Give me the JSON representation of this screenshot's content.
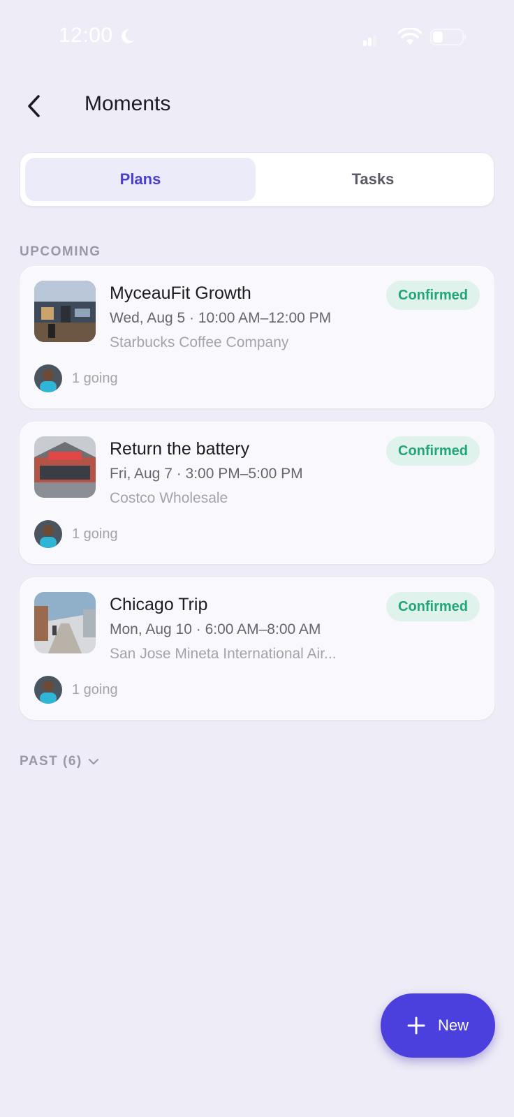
{
  "status_bar": {
    "time": "12:00"
  },
  "header": {
    "title": "Moments"
  },
  "tabs": [
    {
      "label": "Plans",
      "active": true
    },
    {
      "label": "Tasks",
      "active": false
    }
  ],
  "upcoming": {
    "label": "UPCOMING",
    "items": [
      {
        "title": "MyceauFit Growth",
        "time": "Wed, Aug 5 · 10:00 AM–12:00 PM",
        "location": "Starbucks Coffee Company",
        "status": "Confirmed",
        "going": "1 going"
      },
      {
        "title": "Return the battery",
        "time": "Fri, Aug 7 · 3:00 PM–5:00 PM",
        "location": "Costco Wholesale",
        "status": "Confirmed",
        "going": "1 going"
      },
      {
        "title": "Chicago Trip",
        "time": "Mon, Aug 10 · 6:00 AM–8:00 AM",
        "location": "San Jose Mineta International Air...",
        "status": "Confirmed",
        "going": "1 going"
      }
    ]
  },
  "past": {
    "label": "PAST (6)"
  },
  "fab": {
    "label": "New"
  },
  "colors": {
    "accent": "#4b3fdd",
    "confirmed_bg": "#dff3ec",
    "confirmed_text": "#22a57a",
    "background": "#eeecf6"
  }
}
